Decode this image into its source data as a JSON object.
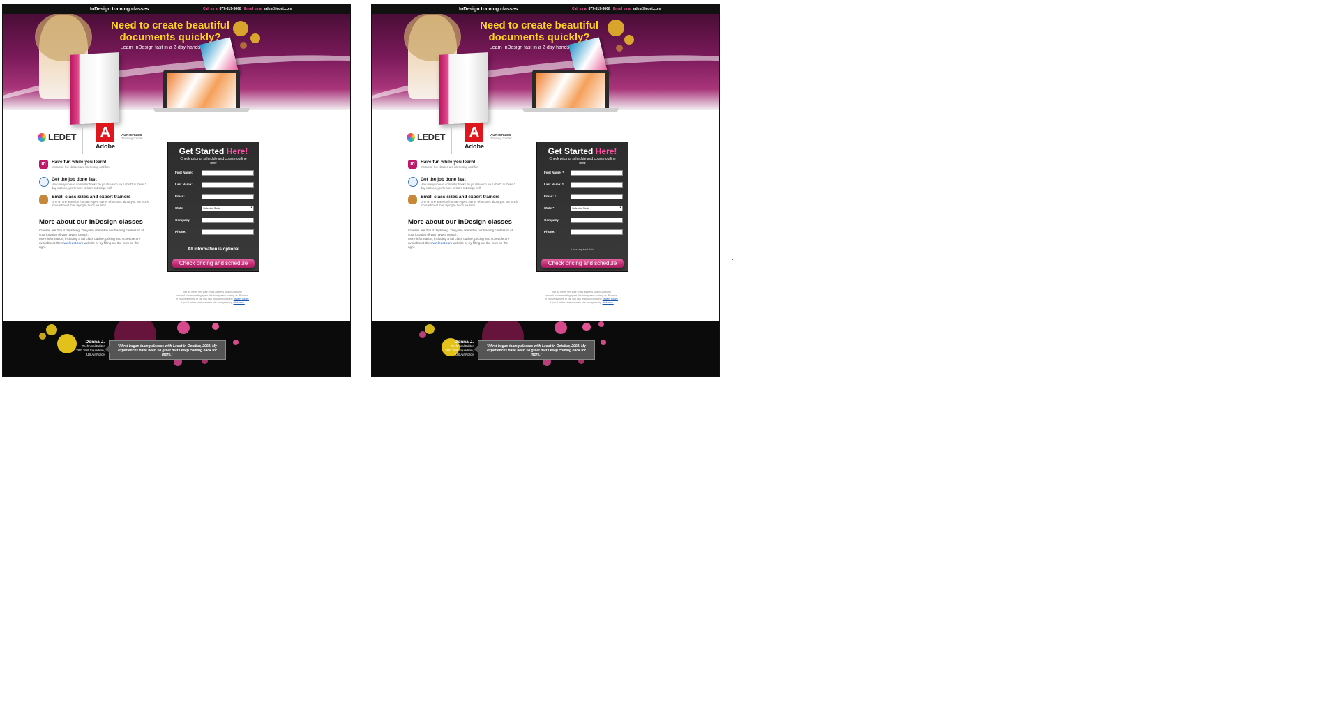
{
  "top_bar": {
    "site_title": "InDesign training classes",
    "call_prefix": "Call us at",
    "phone": "877-819-3668",
    "email_prefix": "Email us at",
    "email": "sales@ledet.com"
  },
  "hero": {
    "headline_line1": "Need to create beautiful",
    "headline_line2": "documents quickly?",
    "subline": "Learn InDesign fast in a 2-day hands-on class"
  },
  "logos": {
    "ledet": "LEDET",
    "adobe": "Adobe",
    "authorized": "AUTHORIZED",
    "training_center": "Training Center"
  },
  "features": [
    {
      "icon": "indesign-icon",
      "title": "Have fun while you learn!",
      "desc": "Instructor-led classes are interesting and fun."
    },
    {
      "icon": "clock-icon",
      "title": "Get the job done fast",
      "desc": "How many unread computer books do you have on your shelf? In these 2 day classes, you're sure to learn InDesign well."
    },
    {
      "icon": "trainer-icon",
      "title": "Small class sizes and expert trainers",
      "desc": "One on one attention from an expert trainer who cares about you. It's much more efficient than trying to teach yourself."
    }
  ],
  "more": {
    "title": "More about our InDesign classes",
    "body1": "Classes are 2 to 4 days long. They are offered in our training centers or at your location (if you have a group).",
    "body2": "More information, including a full class outline, pricing and schedule are available at the",
    "link": "www.ledet.com",
    "body3": "website or by filling out the form on the right."
  },
  "variants": {
    "a": {
      "form": {
        "title": "Get Started",
        "title_accent": "Here!",
        "subtitle": "Check pricing, schedule and course outline now",
        "labels": {
          "first_name": "First Name:",
          "last_name": "Last Name:",
          "email": "Email:",
          "state": "State",
          "company": "Company:",
          "phone": "Phone:"
        },
        "state_placeholder": "Select a State",
        "note": "All information is optional",
        "cta": "Check pricing and schedule"
      }
    },
    "b": {
      "form": {
        "title": "Get Started",
        "title_accent": "Here!",
        "subtitle": "Check pricing, schedule and course outline now",
        "labels": {
          "first_name": "First Name: *",
          "last_name": "Last Name: *",
          "email": "Email: *",
          "state": "State *",
          "company": "Company:",
          "phone": "Phone:"
        },
        "state_placeholder": "Select a State",
        "note": "* is a required field",
        "cta": "Check pricing and schedule"
      }
    }
  },
  "privacy": {
    "line1": "We do never sell your email address to any 3rd party",
    "line2": "or send you marketing spam. It's totally easy to drop us. Promise.",
    "line3": "If you've got time to kill, you can read our complete",
    "policy_link": "privacy policy.",
    "line4": "If you'd rather start our main site anonymously,",
    "click_link": "click here."
  },
  "testimonial": {
    "name": "Donna J.",
    "role": "Technical Editor",
    "unit": "28th Test Squadron,",
    "org": "US Air Force",
    "quote": "\"I first began taking classes with Ledet in October, 2002. My experiences have been so great that I keep coming back for more.\""
  },
  "colors": {
    "brand_magenta": "#a9357a",
    "accent_yellow": "#ffd21f",
    "accent_pink": "#ff4fa3",
    "form_bg": "#2c2c2c",
    "cta_pink": "#c22a74",
    "footer_bg": "#0b0b0b",
    "adobe_red": "#e0161d"
  }
}
